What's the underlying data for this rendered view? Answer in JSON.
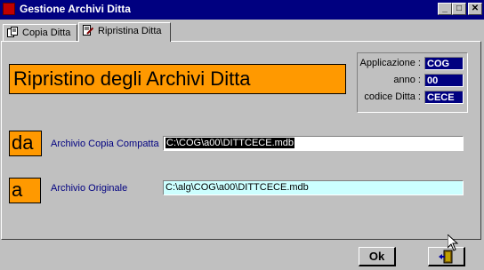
{
  "window": {
    "title": "Gestione Archivi Ditta"
  },
  "title_buttons": {
    "minimize": "_",
    "maximize": "□",
    "close": "✕"
  },
  "tabs": [
    {
      "label": "Copia Ditta",
      "icon": "copy-icon",
      "active": false
    },
    {
      "label": "Ripristina Ditta",
      "icon": "edit-icon",
      "active": true
    }
  ],
  "main": {
    "title": "Ripristino degli Archivi Ditta"
  },
  "info": {
    "applicazione_label": "Applicazione :",
    "applicazione_value": "COG",
    "anno_label": "anno :",
    "anno_value": "00",
    "codice_label": "codice Ditta :",
    "codice_value": "CECE"
  },
  "source": {
    "badge": "da",
    "label": "Archivio Copia Compatta",
    "value": "C:\\COG\\a00\\DITTCECE.mdb"
  },
  "target": {
    "badge": "a",
    "label": "Archivio Originale",
    "value": "C:\\alg\\COG\\a00\\DITTCECE.mdb"
  },
  "buttons": {
    "ok": "Ok",
    "exit_icon": "exit-door-icon"
  },
  "colors": {
    "accent_orange": "#ff9900",
    "titlebar": "#000080",
    "field_cyan": "#ccffff"
  }
}
